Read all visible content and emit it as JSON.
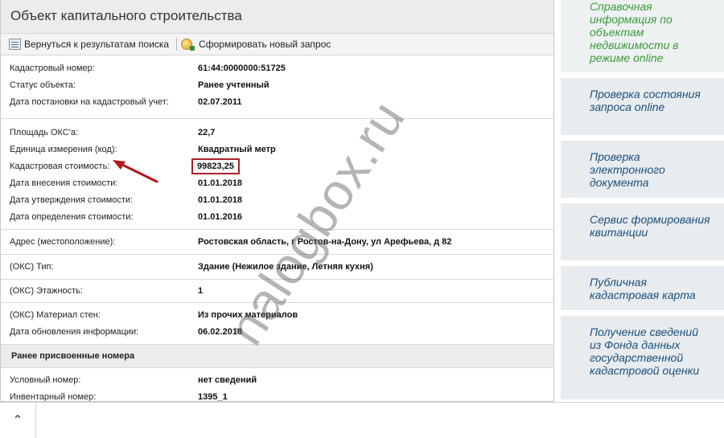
{
  "panel": {
    "title": "Объект капитального строительства",
    "toolbar": {
      "back_label": "Вернуться к результатам поиска",
      "new_query_label": "Сформировать новый запрос"
    }
  },
  "group1": [
    {
      "label": "Кадастровый номер:",
      "value": "61:44:0000000:51725"
    },
    {
      "label": "Статус объекта:",
      "value": "Ранее учтенный"
    },
    {
      "label": "Дата постановки на кадастровый учет:",
      "value": "02.07.2011"
    }
  ],
  "group2": [
    {
      "label": "Площадь ОКС'а:",
      "value": "22,7"
    },
    {
      "label": "Единица измерения (код):",
      "value": "Квадратный метр"
    },
    {
      "label": "Кадастровая стоимость:",
      "value": "99823,25"
    },
    {
      "label": "Дата внесения стоимости:",
      "value": "01.01.2018"
    },
    {
      "label": "Дата утверждения стоимости:",
      "value": "01.01.2018"
    },
    {
      "label": "Дата определения стоимости:",
      "value": "01.01.2016"
    }
  ],
  "address": {
    "label": "Адрес (местоположение):",
    "value": "Ростовская область, г Ростов-на-Дону, ул Арефьева, д 82"
  },
  "oks_type": {
    "label": "(ОКС) Тип:",
    "value": "Здание (Нежилое здание, Летняя кухня)"
  },
  "floors": {
    "label": "(ОКС) Этажность:",
    "value": "1"
  },
  "material": {
    "label": "(ОКС) Материал стен:",
    "value": "Из прочих материалов"
  },
  "update_date": {
    "label": "Дата обновления информации:",
    "value": "06.02.2018"
  },
  "prev_numbers": {
    "header": "Ранее присвоенные номера",
    "rows": [
      {
        "label": "Условный номер:",
        "value": "нет сведений"
      },
      {
        "label": "Инвентарный номер:",
        "value": "1395_1"
      }
    ]
  },
  "sidebar": {
    "items": [
      "Справочная информация по объектам недвижимости в режиме online",
      "Проверка состояния запроса online",
      "Проверка электронного документа",
      "Сервис формирования квитанции",
      "Публичная кадастровая карта",
      "Получение сведений из Фонда данных государственной кадастровой оценки"
    ]
  },
  "watermark": "nalogbox.ru",
  "bottom_bar": {
    "icon": "chevron-up-icon"
  },
  "colors": {
    "highlight_box": "#a8212a",
    "link_blue": "#1d4f7c",
    "link_green": "#3c9a3a"
  }
}
